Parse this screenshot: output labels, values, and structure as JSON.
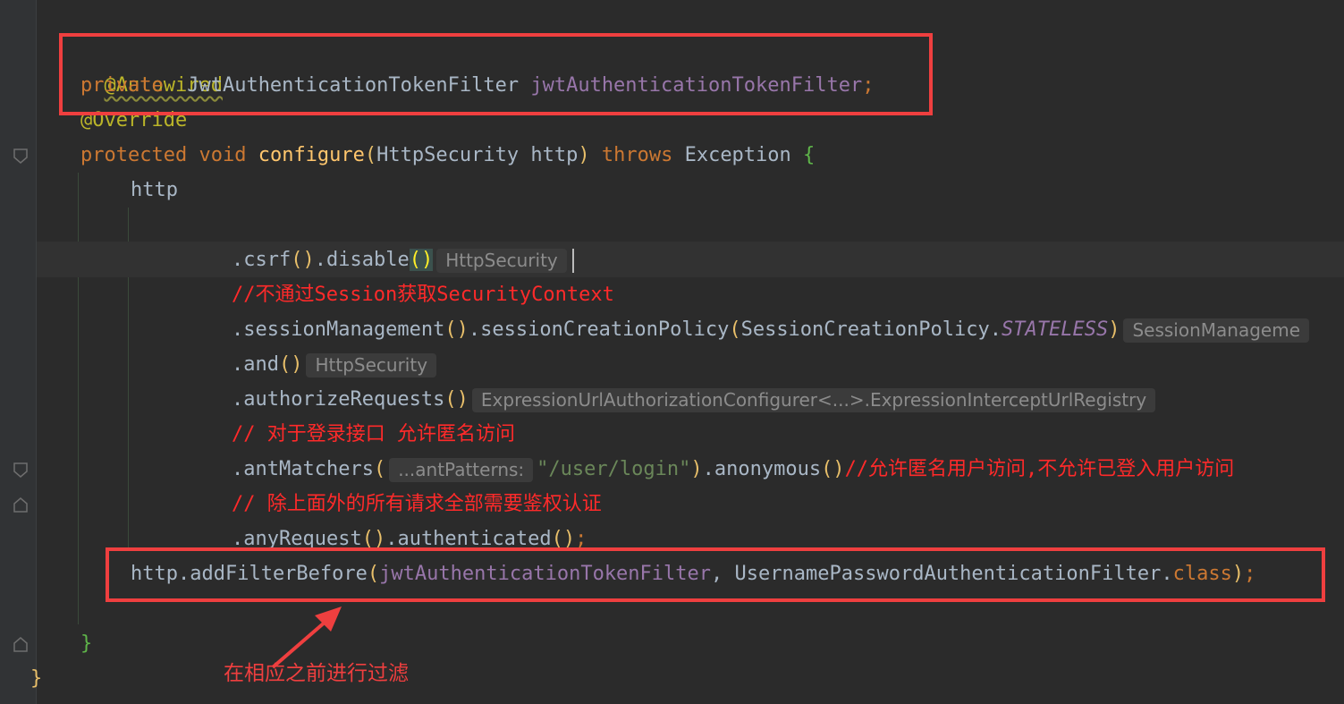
{
  "code": {
    "l1_annotation": "@Autowired",
    "l2_private": "private",
    "l2_type": "JwtAuthenticationTokenFilter",
    "l2_field": "jwtAuthenticationTokenFilter",
    "l2_semicolon": ";",
    "l3_override": "@Override",
    "l4_protected": "protected",
    "l4_void": "void",
    "l4_method": "configure",
    "l4_paren_open": "(",
    "l4_params": "HttpSecurity http",
    "l4_paren_close": ")",
    "l4_throws": "throws",
    "l4_exception": "Exception",
    "l4_brace": "{",
    "l5_http": "http",
    "l7_a": ".csrf",
    "l7_b": "()",
    "l7_c": ".disable",
    "l7_d": "()",
    "l7_hint": "HttpSecurity",
    "l8_comment": "//不通过Session获取SecurityContext",
    "l9_a": ".sessionManagement",
    "l9_b": "()",
    "l9_c": ".sessionCreationPolicy",
    "l9_d": "(",
    "l9_e": "SessionCreationPolicy.",
    "l9_f": "STATELESS",
    "l9_g": ")",
    "l9_hint": "SessionManageme",
    "l10_a": ".and",
    "l10_b": "()",
    "l10_hint": "HttpSecurity",
    "l11_a": ".authorizeRequests",
    "l11_b": "()",
    "l11_hint": "ExpressionUrlAuthorizationConfigurer<...>.ExpressionInterceptUrlRegistry",
    "l12_comment": "// 对于登录接口 允许匿名访问",
    "l13_a": ".antMatchers",
    "l13_b": "(",
    "l13_hint": "...antPatterns:",
    "l13_str": "\"/user/login\"",
    "l13_c": ")",
    "l13_d": ".anonymous",
    "l13_e": "()",
    "l13_comment": "//允许匿名用户访问,不允许已登入用户访问",
    "l14_comment": "// 除上面外的所有请求全部需要鉴权认证",
    "l15_a": ".anyRequest",
    "l15_b": "()",
    "l15_c": ".authenticated",
    "l15_d": "()",
    "l15_e": ";",
    "l16_a": "http.addFilterBefore",
    "l16_b": "(",
    "l16_field": "jwtAuthenticationTokenFilter",
    "l16_c": ", UsernamePasswordAuthenticationFilter.",
    "l16_class": "class",
    "l16_d": ")",
    "l16_e": ";",
    "l18_brace": "}",
    "l19_brace": "}"
  },
  "annotation_text": "在相应之前进行过滤",
  "colors": {
    "background": "#2b2b2b",
    "keyword": "#cc7832",
    "annotation": "#bbb529",
    "method": "#ffc66d",
    "field": "#9876aa",
    "string": "#6a8759",
    "comment": "#ff2a2a",
    "highlight_box": "#ef3f3f"
  }
}
